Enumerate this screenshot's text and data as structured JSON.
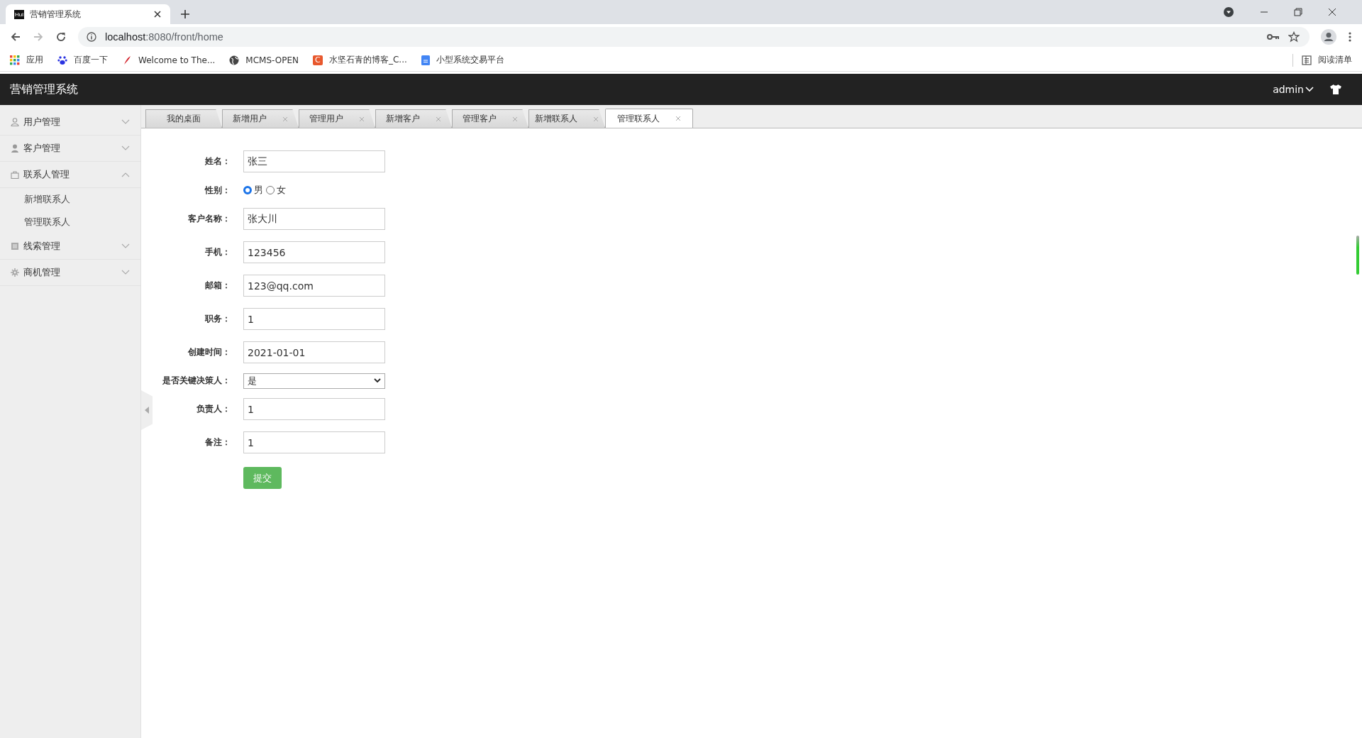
{
  "browser": {
    "tab_title": "营销管理系统",
    "favicon": "Hui",
    "url_host": "localhost",
    "url_rest": ":8080/front/home",
    "bookmarks": [
      {
        "label": "应用"
      },
      {
        "label": "百度一下"
      },
      {
        "label": "Welcome to The..."
      },
      {
        "label": "MCMS-OPEN"
      },
      {
        "label": "水坚石青的博客_C...",
        "letter": "C"
      },
      {
        "label": "小型系统交易平台"
      }
    ],
    "reading_list": "阅读清单"
  },
  "header": {
    "title": "营销管理系统",
    "user": "admin"
  },
  "sidebar": {
    "items": [
      {
        "label": "用户管理",
        "expanded": false
      },
      {
        "label": "客户管理",
        "expanded": false
      },
      {
        "label": "联系人管理",
        "expanded": true,
        "children": [
          {
            "label": "新增联系人"
          },
          {
            "label": "管理联系人"
          }
        ]
      },
      {
        "label": "线索管理",
        "expanded": false
      },
      {
        "label": "商机管理",
        "expanded": false
      }
    ]
  },
  "tabs": [
    {
      "label": "我的桌面",
      "closable": false,
      "selected": false
    },
    {
      "label": "新增用户",
      "closable": true,
      "selected": false
    },
    {
      "label": "管理用户",
      "closable": true,
      "selected": false
    },
    {
      "label": "新增客户",
      "closable": true,
      "selected": false
    },
    {
      "label": "管理客户",
      "closable": true,
      "selected": false
    },
    {
      "label": "新增联系人",
      "closable": true,
      "selected": false
    },
    {
      "label": "管理联系人",
      "closable": true,
      "selected": true
    }
  ],
  "form": {
    "fields": [
      {
        "label": "姓名：",
        "kind": "text",
        "value": "张三"
      },
      {
        "label": "性别：",
        "kind": "radio",
        "options": [
          {
            "label": "男",
            "selected": true
          },
          {
            "label": "女",
            "selected": false
          }
        ]
      },
      {
        "label": "客户名称：",
        "kind": "text",
        "value": "张大川"
      },
      {
        "label": "手机：",
        "kind": "text",
        "value": "123456"
      },
      {
        "label": "邮箱：",
        "kind": "text",
        "value": "123@qq.com"
      },
      {
        "label": "职务：",
        "kind": "text",
        "value": "1"
      },
      {
        "label": "创建时间：",
        "kind": "text",
        "value": "2021-01-01"
      },
      {
        "label": "是否关键决策人：",
        "kind": "select",
        "value": "是"
      },
      {
        "label": "负责人：",
        "kind": "text",
        "value": "1"
      },
      {
        "label": "备注：",
        "kind": "text",
        "value": "1"
      }
    ],
    "submit": "提交"
  }
}
